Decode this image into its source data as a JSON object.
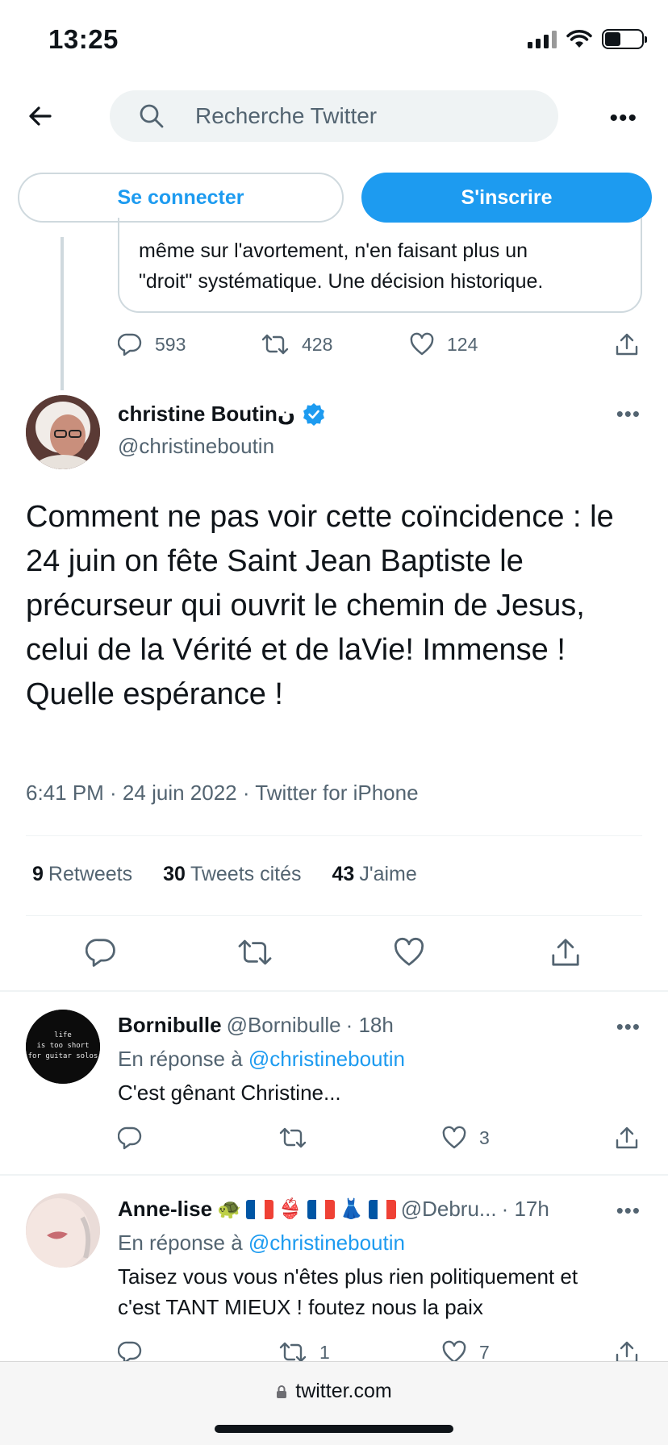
{
  "status_bar": {
    "time": "13:25"
  },
  "header": {
    "search_placeholder": "Recherche Twitter"
  },
  "auth": {
    "login_label": "Se connecter",
    "signup_label": "S'inscrire"
  },
  "quoted_context": {
    "line1": "même sur l'avortement, n'en faisant plus un",
    "line2": "\"droit\" systématique. Une décision historique.",
    "replies": "593",
    "retweets": "428",
    "likes": "124"
  },
  "main_tweet": {
    "author_name": "christine Boutinن",
    "author_handle": "@christineboutin",
    "text": "Comment ne pas voir cette coïncidence : le 24 juin on fête Saint Jean Baptiste  le précurseur qui ouvrit le chemin de Jesus, celui de la Vérité et de laVie! Immense ! Quelle espérance !",
    "meta": "6:41 PM · 24 juin 2022 · Twitter for iPhone",
    "stats": {
      "retweets_count": "9",
      "retweets_label": "Retweets",
      "quotes_count": "30",
      "quotes_label": "Tweets cités",
      "likes_count": "43",
      "likes_label": "J'aime"
    }
  },
  "replies": [
    {
      "name": "Bornibulle",
      "handle": "@Bornibulle",
      "time": "· 18h",
      "reply_prefix": "En réponse à",
      "reply_to": "@christineboutin",
      "text": "C'est gênant Christine...",
      "retweets": "",
      "likes": "3",
      "avatar_text": "life\nis too short\nfor guitar solos"
    },
    {
      "name": "Anne-lise",
      "handle": "@Debru...",
      "time": "· 17h",
      "reply_prefix": "En réponse à",
      "reply_to": "@christineboutin",
      "text_line1": "Taisez vous vous n'êtes plus rien politiquement  et",
      "text_line2": "c'est  TANT MIEUX  ! foutez nous la paix",
      "retweets": "1",
      "likes": "7"
    }
  ],
  "browser": {
    "url": "twitter.com"
  },
  "colors": {
    "accent": "#1d9bf0",
    "text": "#0f1419",
    "secondary": "#536471",
    "border": "#cfd9de"
  }
}
